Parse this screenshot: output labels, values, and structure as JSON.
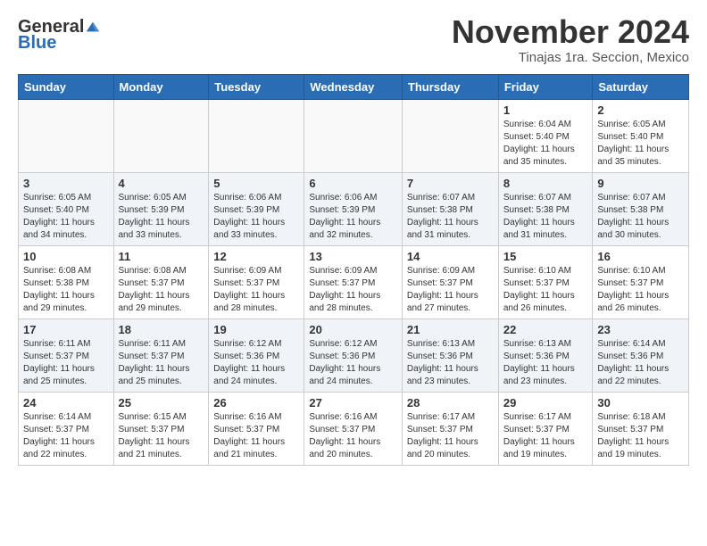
{
  "header": {
    "logo_general": "General",
    "logo_blue": "Blue",
    "month_title": "November 2024",
    "location": "Tinajas 1ra. Seccion, Mexico"
  },
  "weekdays": [
    "Sunday",
    "Monday",
    "Tuesday",
    "Wednesday",
    "Thursday",
    "Friday",
    "Saturday"
  ],
  "weeks": [
    [
      {
        "day": "",
        "info": ""
      },
      {
        "day": "",
        "info": ""
      },
      {
        "day": "",
        "info": ""
      },
      {
        "day": "",
        "info": ""
      },
      {
        "day": "",
        "info": ""
      },
      {
        "day": "1",
        "info": "Sunrise: 6:04 AM\nSunset: 5:40 PM\nDaylight: 11 hours\nand 35 minutes."
      },
      {
        "day": "2",
        "info": "Sunrise: 6:05 AM\nSunset: 5:40 PM\nDaylight: 11 hours\nand 35 minutes."
      }
    ],
    [
      {
        "day": "3",
        "info": "Sunrise: 6:05 AM\nSunset: 5:40 PM\nDaylight: 11 hours\nand 34 minutes."
      },
      {
        "day": "4",
        "info": "Sunrise: 6:05 AM\nSunset: 5:39 PM\nDaylight: 11 hours\nand 33 minutes."
      },
      {
        "day": "5",
        "info": "Sunrise: 6:06 AM\nSunset: 5:39 PM\nDaylight: 11 hours\nand 33 minutes."
      },
      {
        "day": "6",
        "info": "Sunrise: 6:06 AM\nSunset: 5:39 PM\nDaylight: 11 hours\nand 32 minutes."
      },
      {
        "day": "7",
        "info": "Sunrise: 6:07 AM\nSunset: 5:38 PM\nDaylight: 11 hours\nand 31 minutes."
      },
      {
        "day": "8",
        "info": "Sunrise: 6:07 AM\nSunset: 5:38 PM\nDaylight: 11 hours\nand 31 minutes."
      },
      {
        "day": "9",
        "info": "Sunrise: 6:07 AM\nSunset: 5:38 PM\nDaylight: 11 hours\nand 30 minutes."
      }
    ],
    [
      {
        "day": "10",
        "info": "Sunrise: 6:08 AM\nSunset: 5:38 PM\nDaylight: 11 hours\nand 29 minutes."
      },
      {
        "day": "11",
        "info": "Sunrise: 6:08 AM\nSunset: 5:37 PM\nDaylight: 11 hours\nand 29 minutes."
      },
      {
        "day": "12",
        "info": "Sunrise: 6:09 AM\nSunset: 5:37 PM\nDaylight: 11 hours\nand 28 minutes."
      },
      {
        "day": "13",
        "info": "Sunrise: 6:09 AM\nSunset: 5:37 PM\nDaylight: 11 hours\nand 28 minutes."
      },
      {
        "day": "14",
        "info": "Sunrise: 6:09 AM\nSunset: 5:37 PM\nDaylight: 11 hours\nand 27 minutes."
      },
      {
        "day": "15",
        "info": "Sunrise: 6:10 AM\nSunset: 5:37 PM\nDaylight: 11 hours\nand 26 minutes."
      },
      {
        "day": "16",
        "info": "Sunrise: 6:10 AM\nSunset: 5:37 PM\nDaylight: 11 hours\nand 26 minutes."
      }
    ],
    [
      {
        "day": "17",
        "info": "Sunrise: 6:11 AM\nSunset: 5:37 PM\nDaylight: 11 hours\nand 25 minutes."
      },
      {
        "day": "18",
        "info": "Sunrise: 6:11 AM\nSunset: 5:37 PM\nDaylight: 11 hours\nand 25 minutes."
      },
      {
        "day": "19",
        "info": "Sunrise: 6:12 AM\nSunset: 5:36 PM\nDaylight: 11 hours\nand 24 minutes."
      },
      {
        "day": "20",
        "info": "Sunrise: 6:12 AM\nSunset: 5:36 PM\nDaylight: 11 hours\nand 24 minutes."
      },
      {
        "day": "21",
        "info": "Sunrise: 6:13 AM\nSunset: 5:36 PM\nDaylight: 11 hours\nand 23 minutes."
      },
      {
        "day": "22",
        "info": "Sunrise: 6:13 AM\nSunset: 5:36 PM\nDaylight: 11 hours\nand 23 minutes."
      },
      {
        "day": "23",
        "info": "Sunrise: 6:14 AM\nSunset: 5:36 PM\nDaylight: 11 hours\nand 22 minutes."
      }
    ],
    [
      {
        "day": "24",
        "info": "Sunrise: 6:14 AM\nSunset: 5:37 PM\nDaylight: 11 hours\nand 22 minutes."
      },
      {
        "day": "25",
        "info": "Sunrise: 6:15 AM\nSunset: 5:37 PM\nDaylight: 11 hours\nand 21 minutes."
      },
      {
        "day": "26",
        "info": "Sunrise: 6:16 AM\nSunset: 5:37 PM\nDaylight: 11 hours\nand 21 minutes."
      },
      {
        "day": "27",
        "info": "Sunrise: 6:16 AM\nSunset: 5:37 PM\nDaylight: 11 hours\nand 20 minutes."
      },
      {
        "day": "28",
        "info": "Sunrise: 6:17 AM\nSunset: 5:37 PM\nDaylight: 11 hours\nand 20 minutes."
      },
      {
        "day": "29",
        "info": "Sunrise: 6:17 AM\nSunset: 5:37 PM\nDaylight: 11 hours\nand 19 minutes."
      },
      {
        "day": "30",
        "info": "Sunrise: 6:18 AM\nSunset: 5:37 PM\nDaylight: 11 hours\nand 19 minutes."
      }
    ]
  ]
}
